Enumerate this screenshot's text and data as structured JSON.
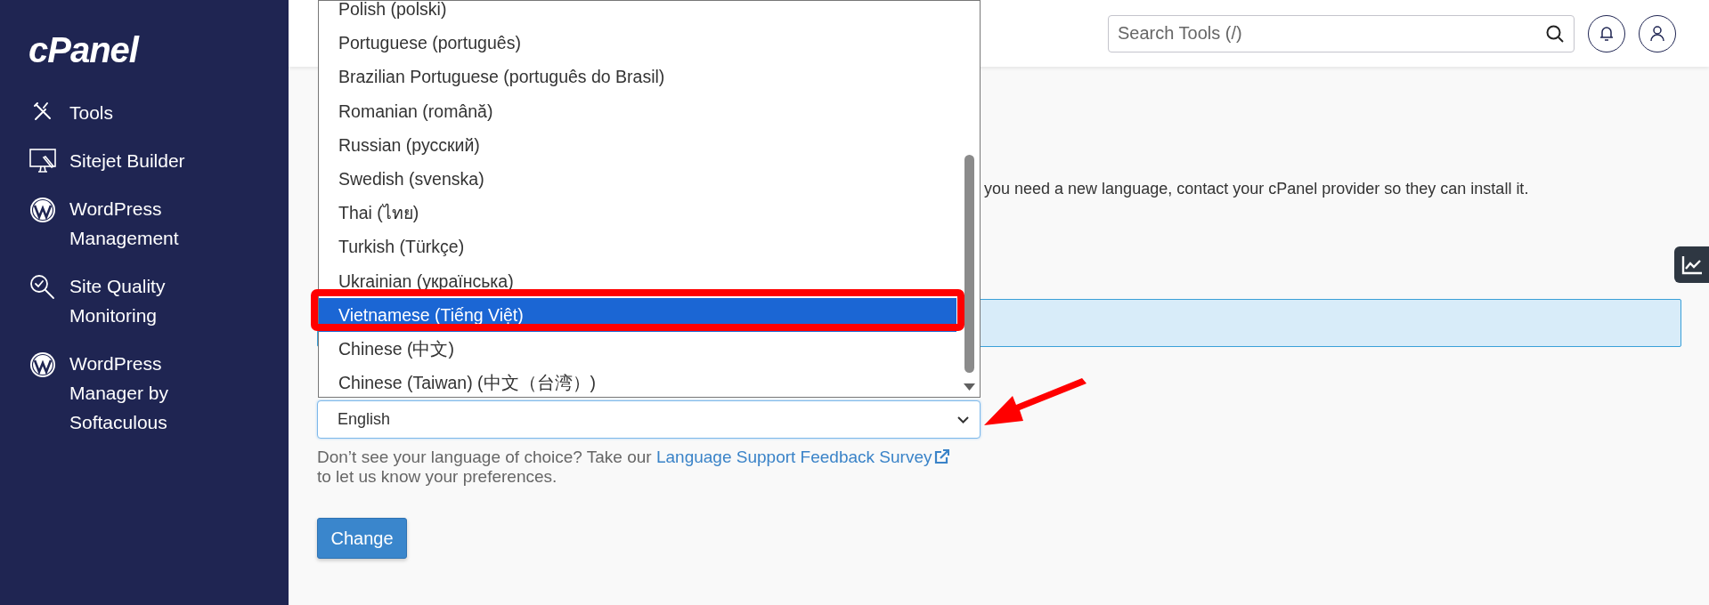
{
  "sidebar": {
    "logo": "cPanel",
    "items": [
      {
        "label": "Tools",
        "kind": "tools"
      },
      {
        "label": "Sitejet Builder",
        "kind": "monitor"
      },
      {
        "label": "WordPress Management",
        "kind": "wordpress"
      },
      {
        "label": "Site Quality Monitoring",
        "kind": "quality"
      },
      {
        "label": "WordPress Manager by Softaculous",
        "kind": "wordpress"
      }
    ]
  },
  "header": {
    "search": {
      "placeholder": "Search Tools (/)"
    }
  },
  "content": {
    "intro_text": "you need a new language, contact your cPanel provider so they can install it.",
    "language_select": {
      "value": "English",
      "expanded": true,
      "options": [
        {
          "label": "Polish (polski)",
          "selected": false
        },
        {
          "label": "Portuguese (português)",
          "selected": false
        },
        {
          "label": "Brazilian Portuguese (português do Brasil)",
          "selected": false
        },
        {
          "label": "Romanian (română)",
          "selected": false
        },
        {
          "label": "Russian (русский)",
          "selected": false
        },
        {
          "label": "Swedish (svenska)",
          "selected": false
        },
        {
          "label": "Thai (ไทย)",
          "selected": false
        },
        {
          "label": "Turkish (Türkçe)",
          "selected": false
        },
        {
          "label": "Ukrainian (українська)",
          "selected": false
        },
        {
          "label": "Vietnamese (Tiếng Việt)",
          "selected": true
        },
        {
          "label": "Chinese (中文)",
          "selected": false
        },
        {
          "label": "Chinese (Taiwan) (中文（台湾）)",
          "selected": false
        }
      ]
    },
    "help_text": {
      "before": "Don’t see your language of choice? Take our",
      "link": "Language Support Feedback Survey",
      "after": "to let us know your preferences."
    },
    "submit_button": "Change"
  }
}
